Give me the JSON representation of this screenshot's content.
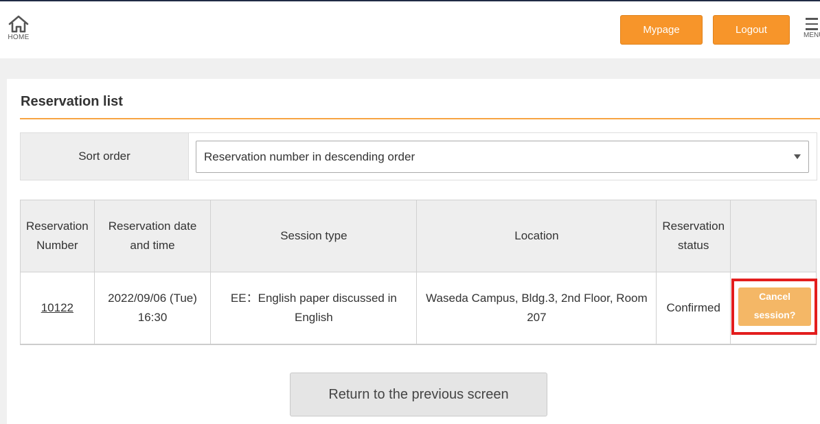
{
  "header": {
    "home_label": "HOME",
    "mypage_label": "Mypage",
    "logout_label": "Logout",
    "menu_label": "MENU"
  },
  "page": {
    "title": "Reservation list",
    "accent_color": "#f7952a",
    "highlight_color": "#e31d1d"
  },
  "sort": {
    "label": "Sort order",
    "selected": "Reservation number in descending order"
  },
  "table": {
    "headers": {
      "number": "Reservation Number",
      "datetime": "Reservation date and time",
      "session_type": "Session type",
      "location": "Location",
      "status": "Reservation status",
      "action": ""
    },
    "rows": [
      {
        "number": "10122",
        "date": "2022/09/06 (Tue)",
        "time": "16:30",
        "session_type": "EE：English paper discussed in English",
        "location": "Waseda Campus, Bldg.3, 2nd Floor, Room 207",
        "status": "Confirmed",
        "action_label": "Cancel session?"
      }
    ]
  },
  "footer": {
    "return_label": "Return to the previous screen"
  }
}
